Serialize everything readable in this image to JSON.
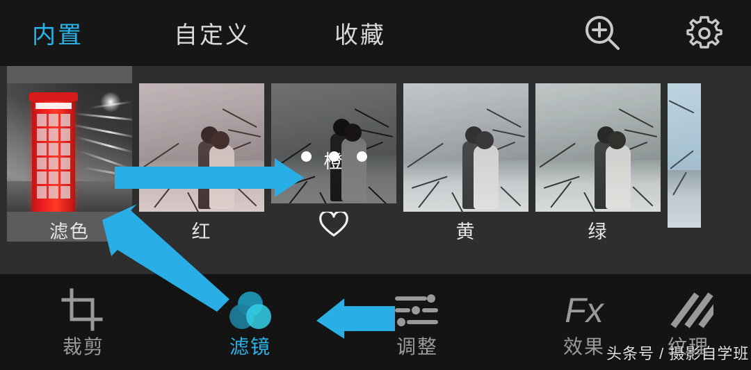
{
  "header": {
    "tabs": [
      {
        "label": "内置",
        "active": true
      },
      {
        "label": "自定义",
        "active": false
      },
      {
        "label": "收藏",
        "active": false
      }
    ],
    "icons": [
      {
        "name": "zoom-in-icon"
      },
      {
        "name": "settings-gear-icon"
      }
    ]
  },
  "filter_strip": {
    "items": [
      {
        "label": "滤色",
        "selected": true,
        "favorited": false,
        "showing_options": false
      },
      {
        "label": "红",
        "selected": false,
        "favorited": false,
        "showing_options": false
      },
      {
        "label": "橙",
        "selected": false,
        "favorited": true,
        "showing_options": true
      },
      {
        "label": "黄",
        "selected": false,
        "favorited": false,
        "showing_options": false
      },
      {
        "label": "绿",
        "selected": false,
        "favorited": false,
        "showing_options": false
      },
      {
        "label": "",
        "selected": false,
        "favorited": false,
        "showing_options": false
      }
    ],
    "option_dots_count": 3,
    "favorite_icon": "heart-outline-icon"
  },
  "toolbar": {
    "items": [
      {
        "label": "裁剪",
        "icon": "crop-icon",
        "active": false
      },
      {
        "label": "滤镜",
        "icon": "filter-circles-icon",
        "active": true
      },
      {
        "label": "调整",
        "icon": "sliders-icon",
        "active": false
      },
      {
        "label": "效果",
        "icon": "fx-icon",
        "active": false,
        "glyph": "Fx"
      },
      {
        "label": "纹理",
        "icon": "texture-stripes-icon",
        "active": false
      }
    ]
  },
  "annotations": {
    "arrows": [
      {
        "name": "arrow-to-orange-filter",
        "direction": "right"
      },
      {
        "name": "arrow-to-screen-filter",
        "direction": "up-left"
      },
      {
        "name": "arrow-to-adjust-tool",
        "direction": "left"
      }
    ],
    "arrow_color": "#29AEE6"
  },
  "watermark": {
    "text": "头条号 / 摄影自学班"
  },
  "colors": {
    "accent": "#27b4e8",
    "arrow": "#29AEE6",
    "topbar_bg": "#161616",
    "strip_bg": "#2e2e2e",
    "selected_bg": "#5c5c5c",
    "toolbar_bg": "#141414",
    "label": "#9a9a9a"
  }
}
